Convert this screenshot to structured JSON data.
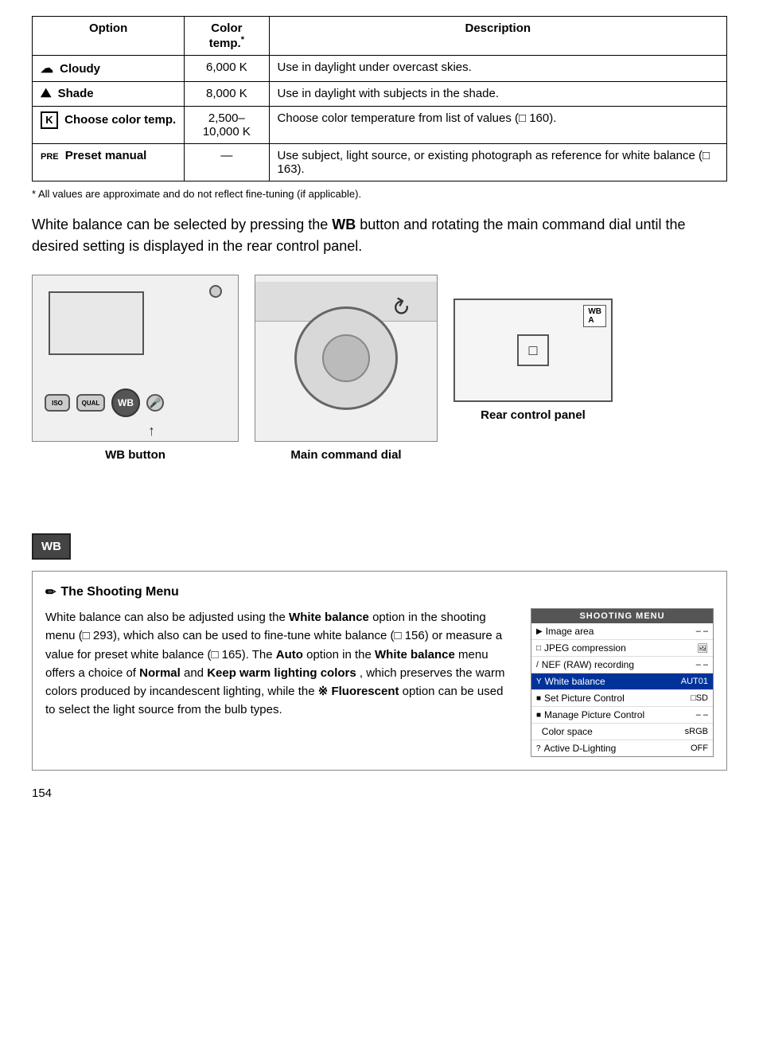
{
  "table": {
    "headers": [
      "Option",
      "Color temp.*",
      "Description"
    ],
    "rows": [
      {
        "icon": "☁",
        "option": "Cloudy",
        "colortemp": "6,000 K",
        "description": "Use in daylight under overcast skies."
      },
      {
        "icon": "🏔",
        "option": "Shade",
        "colortemp": "8,000 K",
        "description": "Use in daylight with subjects in the shade."
      },
      {
        "icon": "K",
        "option": "Choose color temp.",
        "colortemp": "2,500–\n10,000 K",
        "description": "Choose color temperature from list of values (□ 160)."
      },
      {
        "icon": "PRE",
        "option": "Preset manual",
        "colortemp": "—",
        "description": "Use subject, light source, or existing photograph as reference for white balance (□ 163)."
      }
    ],
    "footnote": "* All values are approximate and do not reflect fine-tuning (if applicable)."
  },
  "body_text": "White balance can be selected by pressing the WB button and rotating the main command dial until the desired setting is displayed in the rear control panel.",
  "wb_bold": "WB",
  "diagrams": {
    "wb_button_label": "WB button",
    "main_dial_label": "Main command dial",
    "rear_panel_label": "Rear control panel"
  },
  "wb_sidebar_label": "WB",
  "note": {
    "title": "The Shooting Menu",
    "pencil": "✏",
    "text_parts": [
      "White balance can also be adjusted using the ",
      "White balance",
      " option in the shooting menu (□ 293), which also can be used to fine-tune white balance (□ 156) or measure a value for preset white balance (□ 165).  The ",
      "Auto",
      " option in the ",
      "White balance",
      " menu offers a choice of ",
      "Normal",
      " and ",
      "Keep warm lighting colors",
      ", which preserves the warm colors produced by incandescent lighting, while the ",
      "fluorescent",
      " Fluorescent",
      " option can be used to select the light source from the bulb types."
    ],
    "menu": {
      "title": "SHOOTING MENU",
      "rows": [
        {
          "icon": "▶",
          "name": "Image area",
          "value": "– –",
          "highlighted": false
        },
        {
          "icon": "□",
          "name": "JPEG compression",
          "value": "🖼",
          "highlighted": false
        },
        {
          "icon": "/",
          "name": "NEF (RAW) recording",
          "value": "– –",
          "highlighted": false
        },
        {
          "icon": "Y",
          "name": "White balance",
          "value": "AUT01",
          "highlighted": true
        },
        {
          "icon": "■",
          "name": "Set Picture Control",
          "value": "□SD",
          "highlighted": false
        },
        {
          "icon": "■",
          "name": "Manage Picture Control",
          "value": "– –",
          "highlighted": false
        },
        {
          "icon": " ",
          "name": "Color space",
          "value": "sRGB",
          "highlighted": false
        },
        {
          "icon": "?",
          "name": "Active D-Lighting",
          "value": "OFF",
          "highlighted": false
        }
      ]
    }
  },
  "page_number": "154"
}
